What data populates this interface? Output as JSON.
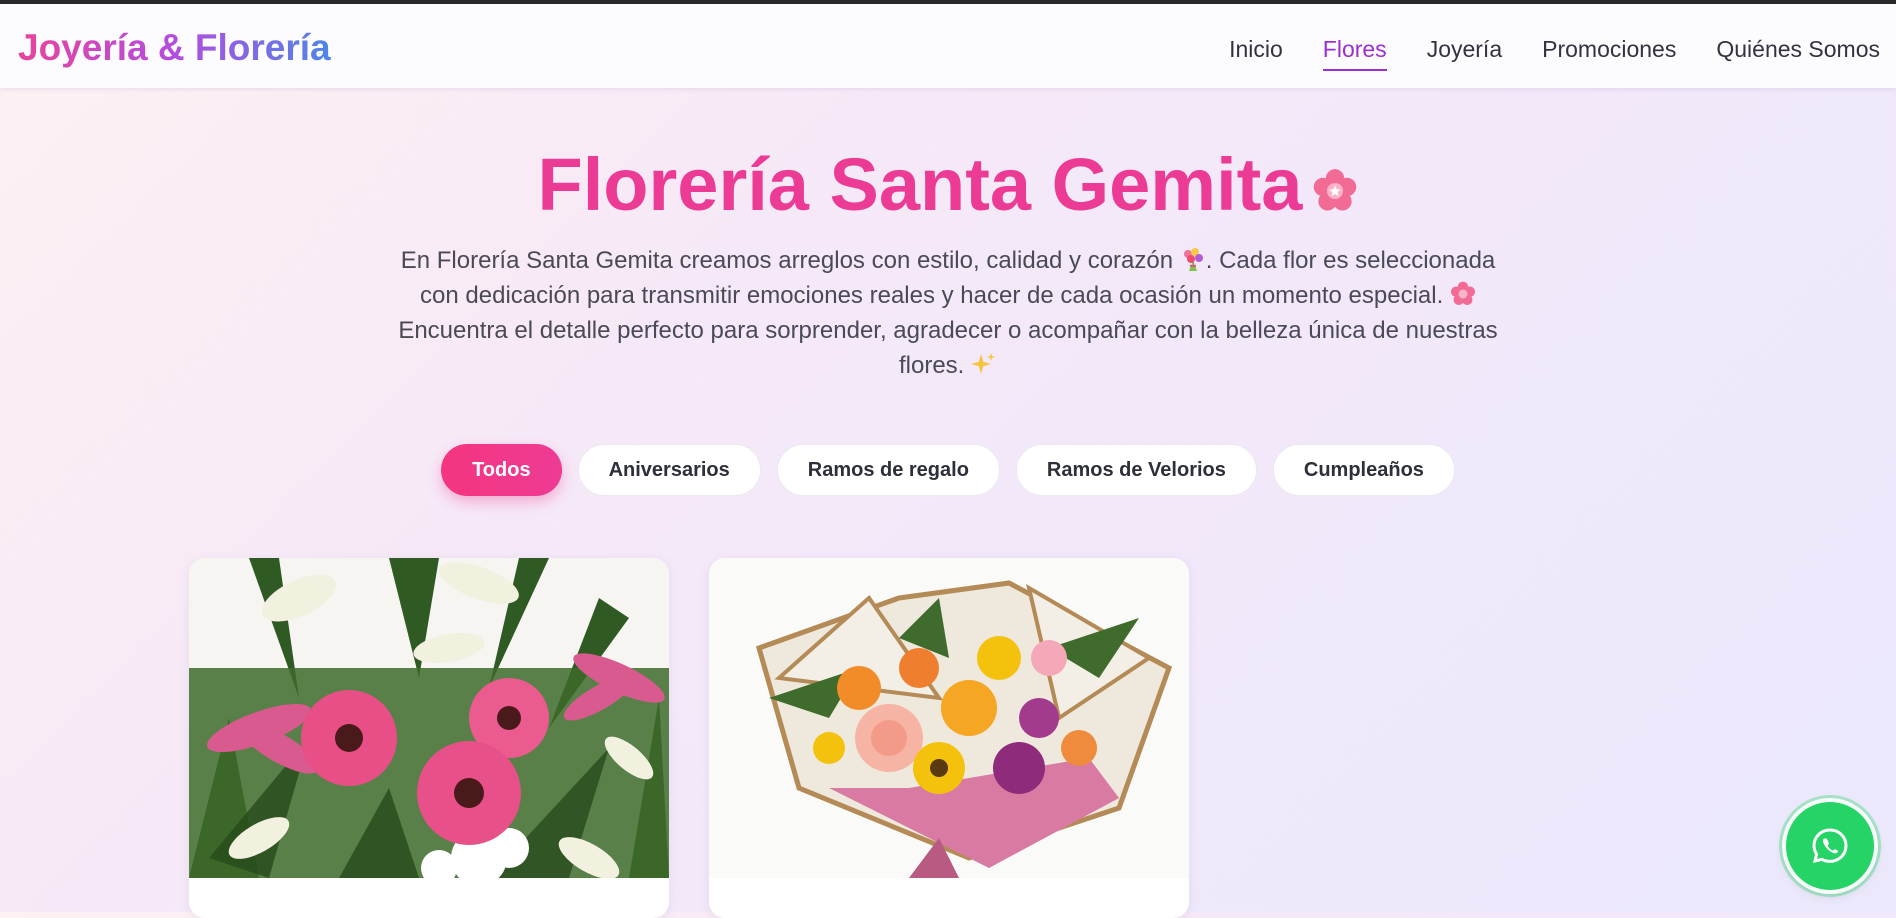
{
  "header": {
    "brand": "Joyería & Florería",
    "nav": [
      {
        "label": "Inicio",
        "active": false
      },
      {
        "label": "Flores",
        "active": true
      },
      {
        "label": "Joyería",
        "active": false
      },
      {
        "label": "Promociones",
        "active": false
      },
      {
        "label": "Quiénes Somos",
        "active": false
      }
    ]
  },
  "hero": {
    "title": "Florería Santa Gemita",
    "title_icon": "cherry-blossom-icon",
    "description_parts": [
      "En Florería Santa Gemita creamos arreglos con estilo, calidad y corazón",
      ". Cada flor es seleccionada con dedicación para transmitir emociones reales y hacer de cada ocasión un momento especial.",
      "Encuentra el detalle perfecto para sorprender, agradecer o acompañar con la belleza única de nuestras flores."
    ],
    "inline_icons": [
      "bouquet-icon",
      "cherry-blossom-icon",
      "sparkles-icon"
    ]
  },
  "filters": [
    {
      "label": "Todos",
      "active": true
    },
    {
      "label": "Aniversarios",
      "active": false
    },
    {
      "label": "Ramos de regalo",
      "active": false
    },
    {
      "label": "Ramos de Velorios",
      "active": false
    },
    {
      "label": "Cumpleaños",
      "active": false
    }
  ],
  "products": [
    {
      "image": "lilies-and-gerberas-arrangement"
    },
    {
      "image": "mixed-bouquet-in-wrap"
    }
  ],
  "whatsapp": {
    "icon": "whatsapp-icon"
  },
  "colors": {
    "accent_pink": "#ec3b95",
    "accent_purple": "#9b2fd1",
    "brand_gradient": [
      "#e7449c",
      "#b34de0",
      "#4d86e6"
    ],
    "whatsapp_green": "#25d366"
  }
}
